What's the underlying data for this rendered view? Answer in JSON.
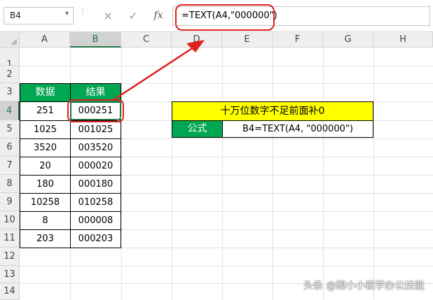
{
  "formula_bar": {
    "name_box": "B4",
    "cancel_icon": "×",
    "enter_icon": "✓",
    "fx_label": "fx",
    "formula": "=TEXT(A4,\"000000\")"
  },
  "columns": [
    "A",
    "B",
    "C",
    "D",
    "E",
    "F",
    "G",
    "H"
  ],
  "rows": [
    "1",
    "2",
    "3",
    "4",
    "5",
    "6",
    "7",
    "8",
    "9",
    "10",
    "11",
    "12",
    "13",
    "14"
  ],
  "table": {
    "header_data": "数据",
    "header_result": "结果",
    "data_values": [
      "251",
      "1025",
      "3520",
      "20",
      "180",
      "10258",
      "8",
      "203"
    ],
    "result_values": [
      "000251",
      "001025",
      "003520",
      "000020",
      "000180",
      "010258",
      "000008",
      "000203"
    ]
  },
  "note": {
    "title": "十万位数字不足前面补0",
    "label": "公式",
    "formula": "B4=TEXT(A4, \"000000\")"
  },
  "watermark": "头条 @跟小小筱学办公技能",
  "colors": {
    "header_green": "#00a651",
    "note_yellow": "#ffff00",
    "highlight_red": "#e0201e",
    "excel_green": "#217346"
  }
}
